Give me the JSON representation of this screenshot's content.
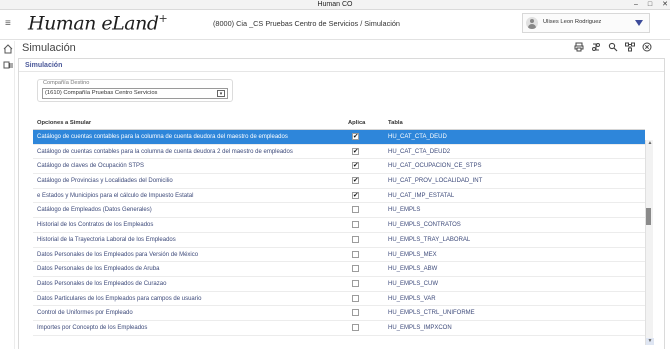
{
  "window": {
    "title": "Human CO"
  },
  "header": {
    "logo_text": "Human eLand",
    "logo_plus": "+",
    "breadcrumb": "(8000) Cia _CS  Pruebas Centro de Servicios /  Simulación",
    "user_name": "Ulises Leon Rodriguez"
  },
  "page": {
    "title": "Simulación"
  },
  "panel": {
    "title": "Simulación",
    "company_label": "Compañía Destino",
    "company_value": "(1610) Compañía Pruebas Centro Servicios"
  },
  "grid": {
    "headers": {
      "option": "Opciones a Simular",
      "apply": "Aplica",
      "table": "Tabla"
    },
    "rows": [
      {
        "option": "Catálogo de cuentas contables para la columna de cuenta deudora del maestro de empleados",
        "checked": true,
        "table": "HU_CAT_CTA_DEUD",
        "selected": true
      },
      {
        "option": "Catálogo de cuentas contables para la columna de cuenta deudora 2 del maestro de empleados",
        "checked": true,
        "table": "HU_CAT_CTA_DEUD2",
        "selected": false
      },
      {
        "option": "Catálogo de claves de Ocupación STPS",
        "checked": true,
        "table": "HU_CAT_OCUPACION_CE_STPS",
        "selected": false
      },
      {
        "option": "Catálogo de Provincias y Localidades del Domicilio",
        "checked": true,
        "table": "HU_CAT_PROV_LOCALIDAD_INT",
        "selected": false
      },
      {
        "option": "e Estados y Municipios para el cálculo de Impuesto Estatal",
        "checked": true,
        "table": "HU_CAT_IMP_ESTATAL",
        "selected": false
      },
      {
        "option": "Catálogo de Empleados (Datos Generales)",
        "checked": false,
        "table": "HU_EMPLS",
        "selected": false
      },
      {
        "option": "Historial de los Contratos de los Empleados",
        "checked": false,
        "table": "HU_EMPLS_CONTRATOS",
        "selected": false
      },
      {
        "option": "Historial de la Trayectoria Laboral de los Empleados",
        "checked": false,
        "table": "HU_EMPLS_TRAY_LABORAL",
        "selected": false
      },
      {
        "option": "Datos Personales de los Empleados para Versión de México",
        "checked": false,
        "table": "HU_EMPLS_MEX",
        "selected": false
      },
      {
        "option": "Datos Personales de los Empleados de Aruba",
        "checked": false,
        "table": "HU_EMPLS_ABW",
        "selected": false
      },
      {
        "option": "Datos Personales de los Empleados de Curazao",
        "checked": false,
        "table": "HU_EMPLS_CUW",
        "selected": false
      },
      {
        "option": "Datos Particulares de los Empleados para campos de usuario",
        "checked": false,
        "table": "HU_EMPLS_VAR",
        "selected": false
      },
      {
        "option": "Control de Uniformes por Empleado",
        "checked": false,
        "table": "HU_EMPLS_CTRL_UNIFORME",
        "selected": false
      },
      {
        "option": "Importes por Concepto de los Empleados",
        "checked": false,
        "table": "HU_EMPLS_IMPXCON",
        "selected": false
      }
    ]
  },
  "icons": {
    "menu": "hamburger-icon",
    "home": "home-icon",
    "side2": "module-icon",
    "print": "print-icon",
    "toolbar2": "settings-sync-icon",
    "toolbar3": "search-icon",
    "toolbar4": "hierarchy-icon",
    "close": "close-icon"
  },
  "colors": {
    "selected_row": "#2e86da",
    "accent": "#3c4b9a"
  }
}
